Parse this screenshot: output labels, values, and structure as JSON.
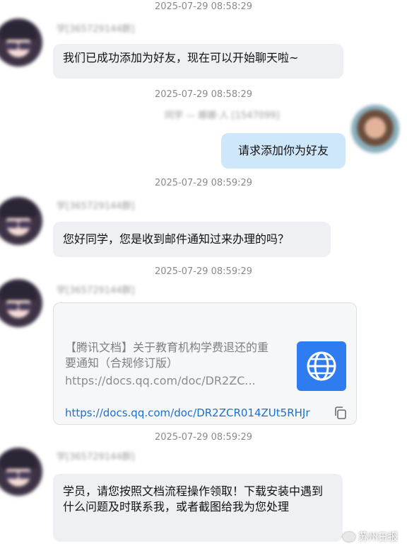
{
  "messages": [
    {
      "time": "2025-07-29 08:58:29",
      "sender": "学[365729144群]",
      "text": "我们已成功添加为好友，现在可以开始聊天啦~"
    },
    {
      "time": "2025-07-29 08:58:29",
      "sender": "同学 — 娜娜·人 [1547099] ",
      "text": "请求添加你为好友"
    },
    {
      "time": "2025-07-29 08:59:29",
      "sender": "学[365729144群]",
      "text": "您好同学，您是收到邮件通知过来办理的吗？"
    },
    {
      "time": "2025-07-29 08:59:29",
      "sender": "学[365729144群]"
    },
    {
      "time": "2025-07-29 08:59:29",
      "sender": "学[365729144群]",
      "text": "学员，请您按照文档流程操作领取！下载安装中遇到什么问题及时联系我，或者截图给我为您处理"
    }
  ],
  "link_card": {
    "title": "【腾讯文档】关于教育机构学费退还的重要通知（合规修订版）",
    "url_preview": "https://docs.qq.com/doc/DR2ZC...",
    "url": "https://docs.qq.com/doc/DR2ZCR014ZUt5RHJr",
    "icon": "globe-icon",
    "accent": "#2f7bf0"
  },
  "watermark": "苏州日报",
  "colors": {
    "bubble_other": "#eef0f3",
    "bubble_mine": "#cfe7fb",
    "link": "#1d6fc9"
  }
}
